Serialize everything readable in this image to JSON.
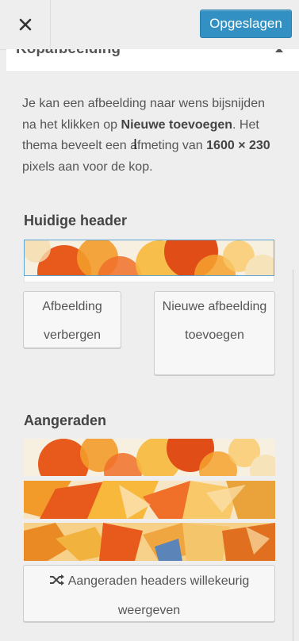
{
  "toolbar": {
    "close_icon": "close-icon",
    "save_label": "Opgeslagen",
    "save_color": "#3291c2"
  },
  "section": {
    "title": "Kopafbeelding"
  },
  "description": {
    "part1": "Je kan een afbeelding naar wens bijsnijden na het klikken op ",
    "bold1": "Nieuwe toevoegen",
    "part2": ". Het thema beveelt een afmeting van ",
    "bold2": "1600 × 230",
    "part3": " pixels aan voor de kop."
  },
  "current": {
    "heading": "Huidige header",
    "hide_button": "Afbeelding verbergen",
    "add_button": "Nieuwe afbeelding toevoegen"
  },
  "suggested": {
    "heading": "Aangeraden",
    "shuffle_icon": "shuffle-icon",
    "shuffle_button": "Aangeraden headers willekeurig weergeven"
  }
}
